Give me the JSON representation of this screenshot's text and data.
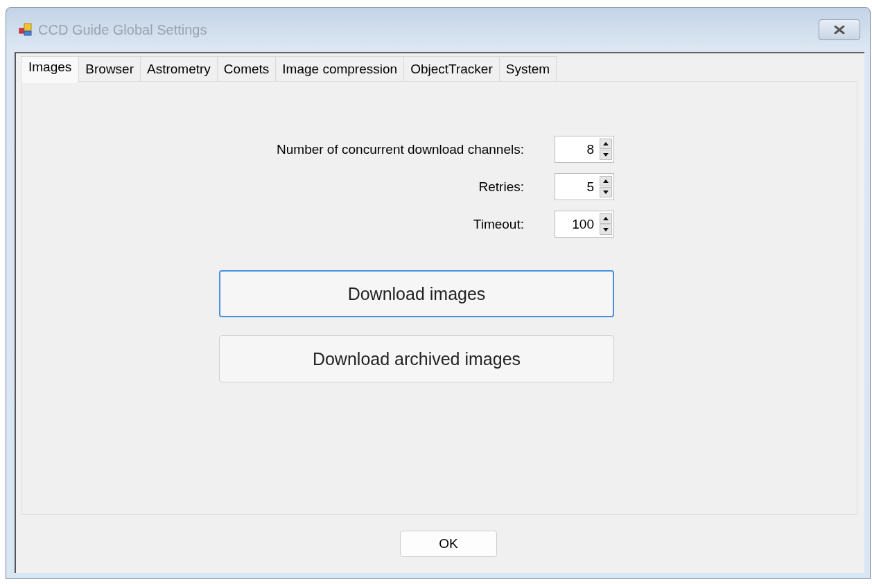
{
  "window": {
    "title": "CCD Guide Global Settings"
  },
  "tabs": [
    {
      "label": "Images",
      "selected": true
    },
    {
      "label": "Browser",
      "selected": false
    },
    {
      "label": "Astrometry",
      "selected": false
    },
    {
      "label": "Comets",
      "selected": false
    },
    {
      "label": "Image compression",
      "selected": false
    },
    {
      "label": "ObjectTracker",
      "selected": false
    },
    {
      "label": "System",
      "selected": false
    }
  ],
  "settings": [
    {
      "label": "Number of concurrent download channels:",
      "value": "8"
    },
    {
      "label": "Retries:",
      "value": "5"
    },
    {
      "label": "Timeout:",
      "value": "100"
    }
  ],
  "buttons": [
    {
      "label": "Download images",
      "focused": true
    },
    {
      "label": "Download archived images",
      "focused": false
    }
  ],
  "ok_button": "OK"
}
